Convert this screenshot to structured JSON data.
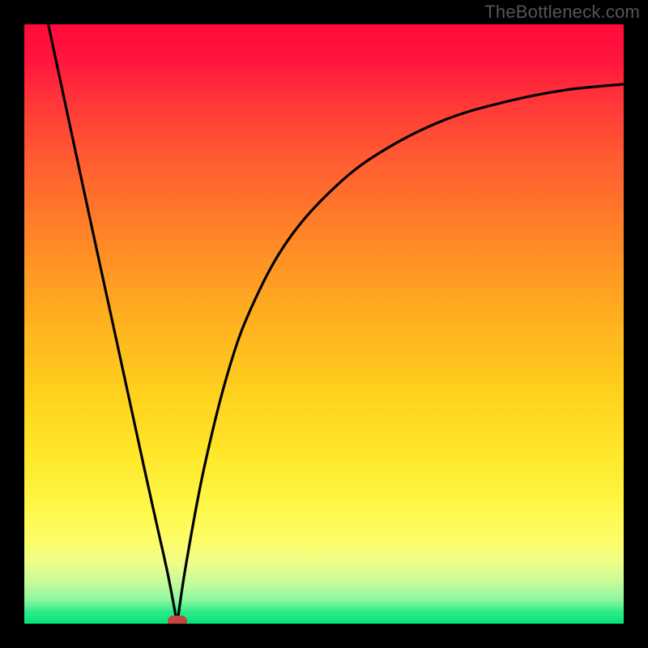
{
  "watermark": "TheBottleneck.com",
  "chart_data": {
    "type": "line",
    "title": "",
    "xlabel": "",
    "ylabel": "",
    "xlim": [
      0,
      100
    ],
    "ylim": [
      0,
      100
    ],
    "grid": false,
    "legend": false,
    "curve_description": "V-shaped bottleneck curve: steep linear descent from top-left to a minimum, then asymptotic rise toward the right.",
    "series": [
      {
        "name": "left-branch",
        "x": [
          4,
          10,
          15,
          20,
          22,
          24,
          25.5
        ],
        "y": [
          100,
          72,
          49,
          26,
          17,
          8,
          0
        ]
      },
      {
        "name": "right-branch",
        "x": [
          25.5,
          27,
          30,
          34,
          38,
          44,
          52,
          60,
          70,
          80,
          90,
          100
        ],
        "y": [
          0,
          10,
          26,
          42,
          53,
          64,
          73,
          79,
          84,
          87,
          89,
          90
        ]
      }
    ],
    "minimum_point": {
      "x": 25.5,
      "y": 0
    },
    "background_gradient": {
      "orientation": "vertical",
      "stops": [
        {
          "pos": 0,
          "color": "#ff0a3a"
        },
        {
          "pos": 50,
          "color": "#ffb81f"
        },
        {
          "pos": 80,
          "color": "#fff646"
        },
        {
          "pos": 100,
          "color": "#06e37a"
        }
      ]
    },
    "marker": {
      "color": "#c0473f",
      "shape": "pill"
    }
  }
}
